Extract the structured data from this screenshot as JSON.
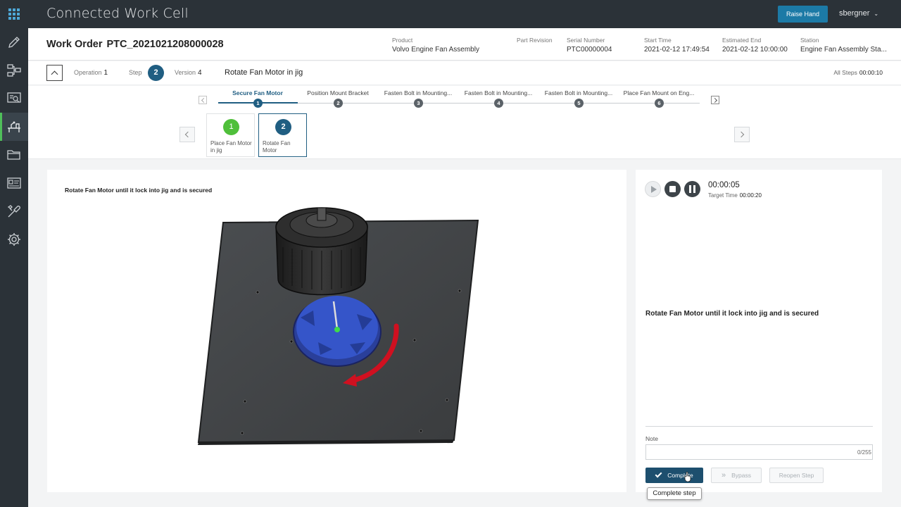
{
  "app": {
    "title": "Connected Work Cell",
    "raise_hand_label": "Raise Hand",
    "user_name": "sbergner"
  },
  "sidebar": {
    "items": [
      {
        "icon": "pencil-icon"
      },
      {
        "icon": "process-flow-icon"
      },
      {
        "icon": "monitor-search-icon"
      },
      {
        "icon": "workstation-icon",
        "active": true
      },
      {
        "icon": "folder-icon"
      },
      {
        "icon": "id-card-icon"
      },
      {
        "icon": "tools-icon"
      },
      {
        "icon": "gear-icon"
      }
    ]
  },
  "header": {
    "work_order_label": "Work Order",
    "work_order_id": "PTC_2021021208000028",
    "fields": {
      "product": {
        "label": "Product",
        "value": "Volvo Engine Fan Assembly"
      },
      "part_revision": {
        "label": "Part Revision",
        "value": ""
      },
      "serial_number": {
        "label": "Serial Number",
        "value": "PTC00000004"
      },
      "start_time": {
        "label": "Start Time",
        "value": "2021-02-12 17:49:54"
      },
      "estimated_end": {
        "label": "Estimated End",
        "value": "2021-02-12 10:00:00"
      },
      "station": {
        "label": "Station",
        "value": "Engine Fan Assembly Sta..."
      }
    }
  },
  "operation_bar": {
    "operation_label": "Operation",
    "operation_value": "1",
    "step_label": "Step",
    "step_value": "2",
    "version_label": "Version",
    "version_value": "4",
    "step_name": "Rotate Fan Motor in jig",
    "all_steps_label": "All Steps",
    "all_steps_time": "00:00:10"
  },
  "timeline": {
    "active_index": 0,
    "items": [
      {
        "label": "Secure Fan Motor",
        "num": "1"
      },
      {
        "label": "Position Mount Bracket",
        "num": "2"
      },
      {
        "label": "Fasten Bolt in Mounting...",
        "num": "3"
      },
      {
        "label": "Fasten Bolt in Mounting...",
        "num": "4"
      },
      {
        "label": "Fasten Bolt in Mounting...",
        "num": "5"
      },
      {
        "label": "Place Fan Mount on Eng...",
        "num": "6"
      }
    ]
  },
  "step_cards": [
    {
      "num": "1",
      "label": "Place Fan Motor in jig",
      "status": "done"
    },
    {
      "num": "2",
      "label": "Rotate Fan Motor",
      "status": "current"
    }
  ],
  "viewer": {
    "caption": "Rotate Fan Motor until it lock into jig and is secured"
  },
  "panel": {
    "elapsed_time": "00:00:05",
    "target_time_label": "Target Time",
    "target_time_value": "00:00:20",
    "instruction": "Rotate Fan Motor until it lock into jig and is secured",
    "note_label": "Note",
    "note_value": "",
    "note_count": "0/255",
    "complete_label": "Complete",
    "bypass_label": "Bypass",
    "reopen_label": "Reopen Step",
    "tooltip": "Complete step"
  },
  "colors": {
    "dark_bg": "#2b3238",
    "accent_blue": "#205e82",
    "raise_hand_blue": "#1c7aa6",
    "done_green": "#4fbf3a"
  }
}
